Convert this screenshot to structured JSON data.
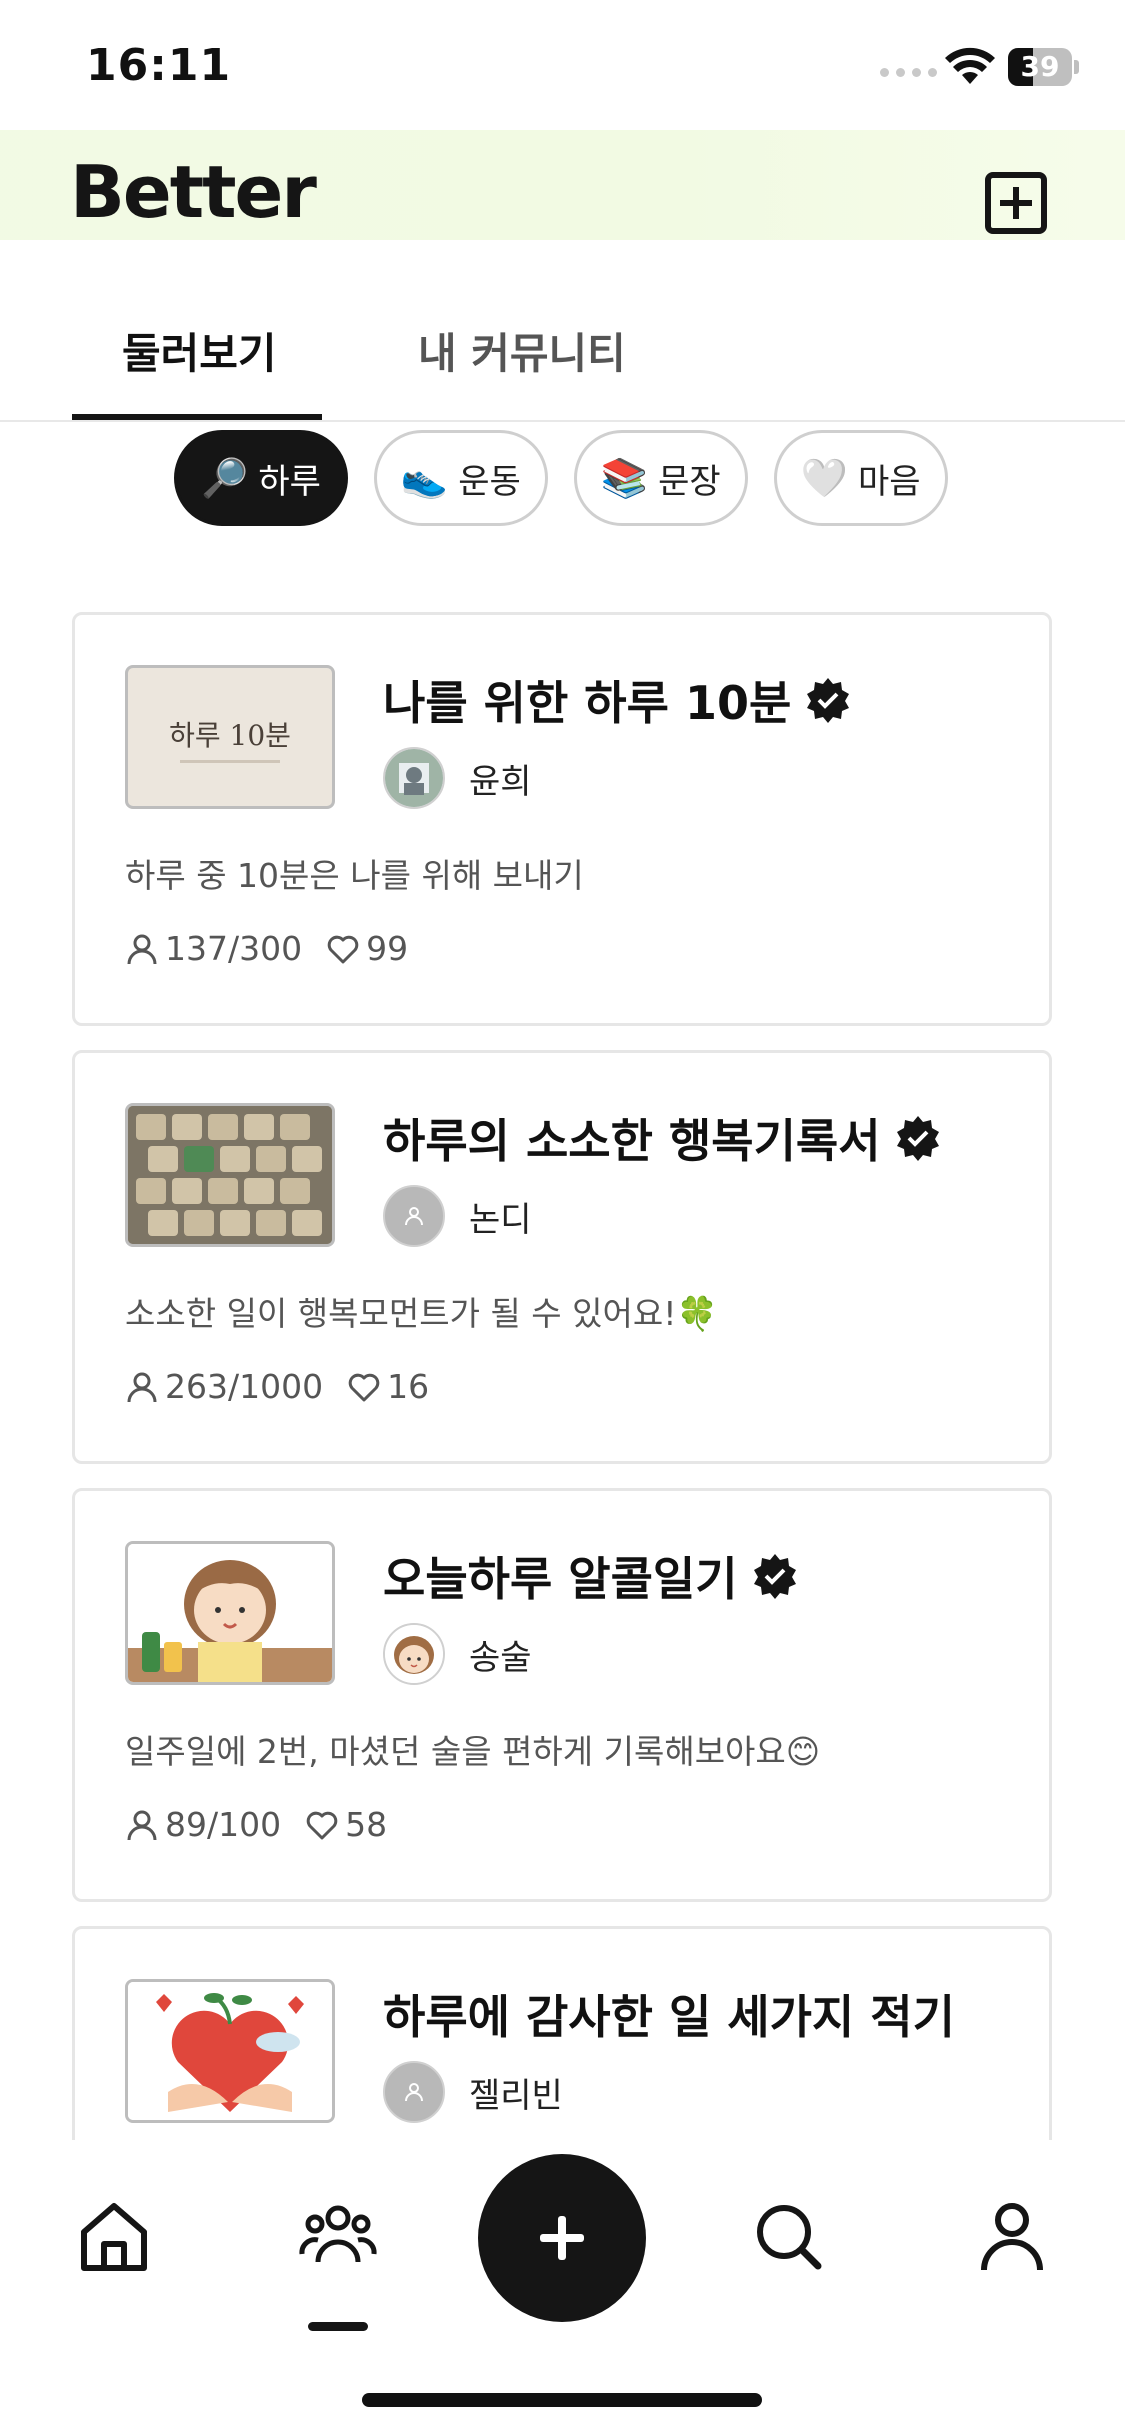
{
  "status_bar": {
    "time": "16:11",
    "battery": "39",
    "battery_level": 0.39
  },
  "header": {
    "logo": "Better"
  },
  "tabs": [
    {
      "label": "둘러보기",
      "active": true
    },
    {
      "label": "내 커뮤니티",
      "active": false
    }
  ],
  "chips": [
    {
      "icon": "🔎",
      "label": "하루",
      "active": true
    },
    {
      "icon": "👟",
      "label": "운동",
      "active": false
    },
    {
      "icon": "📚",
      "label": "문장",
      "active": false
    },
    {
      "icon": "🤍",
      "label": "마음",
      "active": false
    }
  ],
  "cards": [
    {
      "title": "나를 위한 하루 10분",
      "verified": true,
      "author": "윤희",
      "thumb_text": "하루 10분",
      "description": "하루 중 10분은 나를 위해 보내기",
      "members": "137/300",
      "likes": "99"
    },
    {
      "title": "하루의 소소한 행복기록서",
      "verified": true,
      "author": "논디",
      "description": "소소한 일이 행복모먼트가 될 수 있어요!🍀",
      "members": "263/1000",
      "likes": "16"
    },
    {
      "title": "오늘하루 알콜일기",
      "verified": true,
      "author": "송술",
      "description": "일주일에 2번, 마셨던 술을 편하게 기록해보아요😊",
      "members": "89/100",
      "likes": "58"
    },
    {
      "title": "하루에 감사한 일 세가지 적기",
      "verified": false,
      "author": "젤리빈"
    }
  ],
  "bottom_nav": [
    {
      "icon": "home-icon"
    },
    {
      "icon": "community-icon",
      "active": true
    },
    {
      "icon": "add-icon"
    },
    {
      "icon": "search-icon"
    },
    {
      "icon": "profile-icon"
    }
  ],
  "colors": {
    "primary": "#151515",
    "border": "#e6e6e6",
    "muted": "#555555",
    "header_tint": "#eef8dc"
  }
}
